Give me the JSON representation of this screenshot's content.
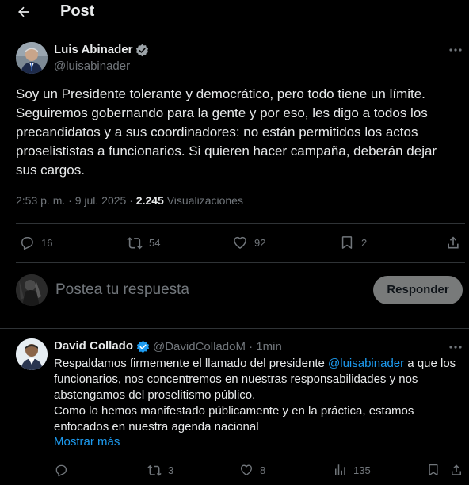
{
  "header": {
    "title": "Post"
  },
  "post": {
    "author_name": "Luis Abinader",
    "author_handle": "@luisabinader",
    "text": "Soy un Presidente tolerante y democrático, pero todo tiene un límite. Seguiremos gobernando para la gente y por eso, les digo a todos los precandidatos y a sus coordinadores: no están permitidos los actos proselististas a funcionarios. Si quieren hacer campaña, deberán dejar sus cargos.",
    "time": "2:53 p. m.",
    "separator": "·",
    "date": "9 jul. 2025",
    "views_count": "2.245",
    "views_label": "Visualizaciones",
    "replies": "16",
    "reposts": "54",
    "likes": "92",
    "bookmarks": "2"
  },
  "composer": {
    "placeholder": "Postea tu respuesta",
    "button_label": "Responder"
  },
  "reply": {
    "author_name": "David Collado",
    "author_handle": "@DavidColladoM",
    "separator": "·",
    "time": "1min",
    "text_before_mention": "Respaldamos firmemente el llamado del presidente ",
    "mention": "@luisabinader",
    "text_after_mention": " a que los funcionarios, nos concentremos en nuestras responsabilidades y nos abstengamos del proselitismo público.",
    "text_line2": "Como lo hemos manifestado públicamente y en la práctica, estamos enfocados en nuestra agenda nacional",
    "show_more": "Mostrar más",
    "replies": "",
    "reposts": "3",
    "likes": "8",
    "views": "135"
  },
  "colors": {
    "background": "#000000",
    "text": "#e7e9ea",
    "muted": "#71767b",
    "accent": "#1d9bf0",
    "divider": "#2f3336"
  },
  "icons": [
    "back-arrow-icon",
    "verified-badge-icon",
    "more-icon",
    "reply-icon",
    "repost-icon",
    "like-icon",
    "bookmark-icon",
    "share-icon",
    "views-icon"
  ]
}
